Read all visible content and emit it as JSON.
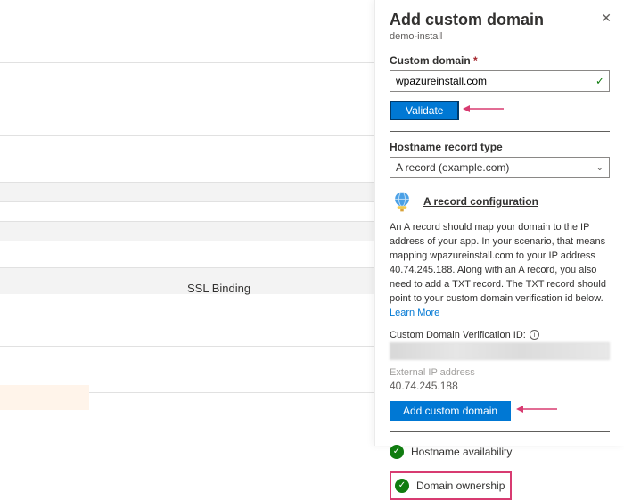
{
  "background": {
    "column_header": "SSL Binding"
  },
  "panel": {
    "title": "Add custom domain",
    "subtitle": "demo-install",
    "custom_domain_label": "Custom domain",
    "custom_domain_value": "wpazureinstall.com",
    "validate_label": "Validate",
    "hostname_record_label": "Hostname record type",
    "hostname_record_value": "A record (example.com)",
    "config_link": "A record configuration",
    "description": "An A record should map your domain to the IP address of your app. In your scenario, that means mapping wpazureinstall.com to your IP address 40.74.245.188. Along with an A record, you also need to add a TXT record. The TXT record should point to your custom domain verification id below. ",
    "learn_more": "Learn More",
    "verification_id_label": "Custom Domain Verification ID:",
    "external_ip_label": "External IP address",
    "external_ip_value": "40.74.245.188",
    "add_domain_label": "Add custom domain",
    "status_hostname": "Hostname availability",
    "status_ownership": "Domain ownership"
  }
}
